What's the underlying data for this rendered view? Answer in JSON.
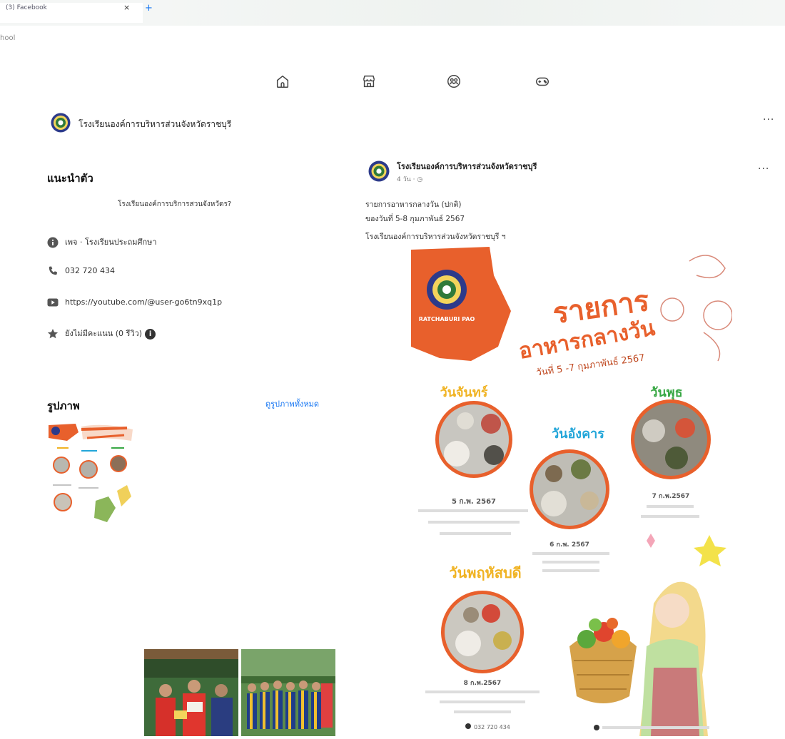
{
  "browser": {
    "tab_title": "(3) Facebook",
    "tab_close": "×",
    "tab_new": "+",
    "address_fragment": "hool"
  },
  "nav": {
    "icons": [
      "home-icon",
      "marketplace-icon",
      "groups-icon",
      "gaming-icon"
    ]
  },
  "page": {
    "name": "โรงเรียนองค์การบริหารส่วนจังหวัดราชบุรี",
    "more": "···"
  },
  "intro": {
    "heading": "แนะนำตัว",
    "bio": "โรงเรียนองค์การบริการสวนจังหวัดร?",
    "category": "เพจ · โรงเรียนประถมศึกษา",
    "phone": "032 720 434",
    "youtube": "https://youtube.com/@user-go6tn9xq1p",
    "rating": "ยังไม่มีคะแนน (0 รีวิว)"
  },
  "photos": {
    "heading": "รูปภาพ",
    "see_all": "ดูรูปภาพทั้งหมด"
  },
  "post": {
    "author": "โรงเรียนองค์การบริหารส่วนจังหวัดราชบุรี",
    "time": "4 วัน · ",
    "more": "···",
    "line1": "รายการอาหารกลางวัน (ปกติ)",
    "line2": "ของวันที่ 5-8 กุมภาพันธ์ 2567",
    "line3": "โรงเรียนองค์การบริหารส่วนจังหวัดราชบุรี ฯ"
  },
  "poster": {
    "brand": "RATCHABURI PAO",
    "title1": "รายการ",
    "title2": "อาหารกลางวัน",
    "dates": "วันที่ 5 -7 กุมภาพันธ์ 2567",
    "day_mon": "วันจันทร์",
    "day_tue": "วันอังคาร",
    "day_wed": "วันพุธ",
    "day_thu": "วันพฤหัสบดี",
    "date_mon": "5 ก.พ. 2567",
    "date_tue": "6 ก.พ. 2567",
    "date_wed": "7 ก.พ.2567",
    "date_thu": "8 ก.พ.2567",
    "phone": "032 720 434",
    "colors": {
      "orange": "#e8602c",
      "gold": "#f0b323",
      "cyan": "#23a6d9",
      "green": "#39a845"
    }
  }
}
